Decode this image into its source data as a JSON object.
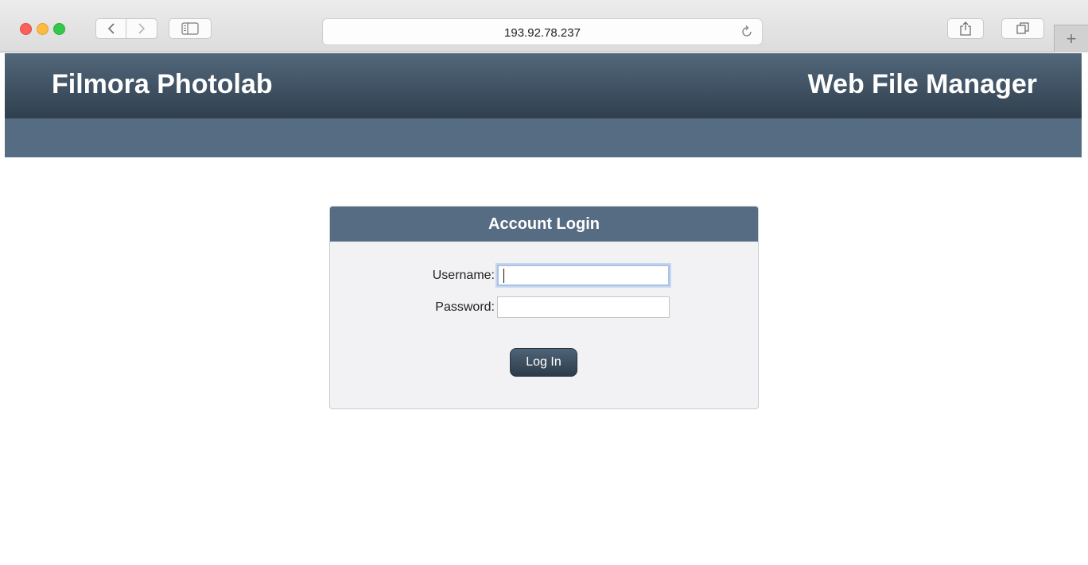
{
  "browser": {
    "url": "193.92.78.237",
    "new_tab_label": "+"
  },
  "site": {
    "brand": "Filmora Photolab",
    "app_title": "Web File Manager"
  },
  "login": {
    "title": "Account Login",
    "username_label": "Username:",
    "username_value": "",
    "password_label": "Password:",
    "password_value": "",
    "submit_label": "Log In"
  },
  "colors": {
    "header_gradient_top": "#53687c",
    "header_gradient_bottom": "#2f3f4d",
    "subbar": "#566c83",
    "panel_background": "#f2f2f4"
  }
}
